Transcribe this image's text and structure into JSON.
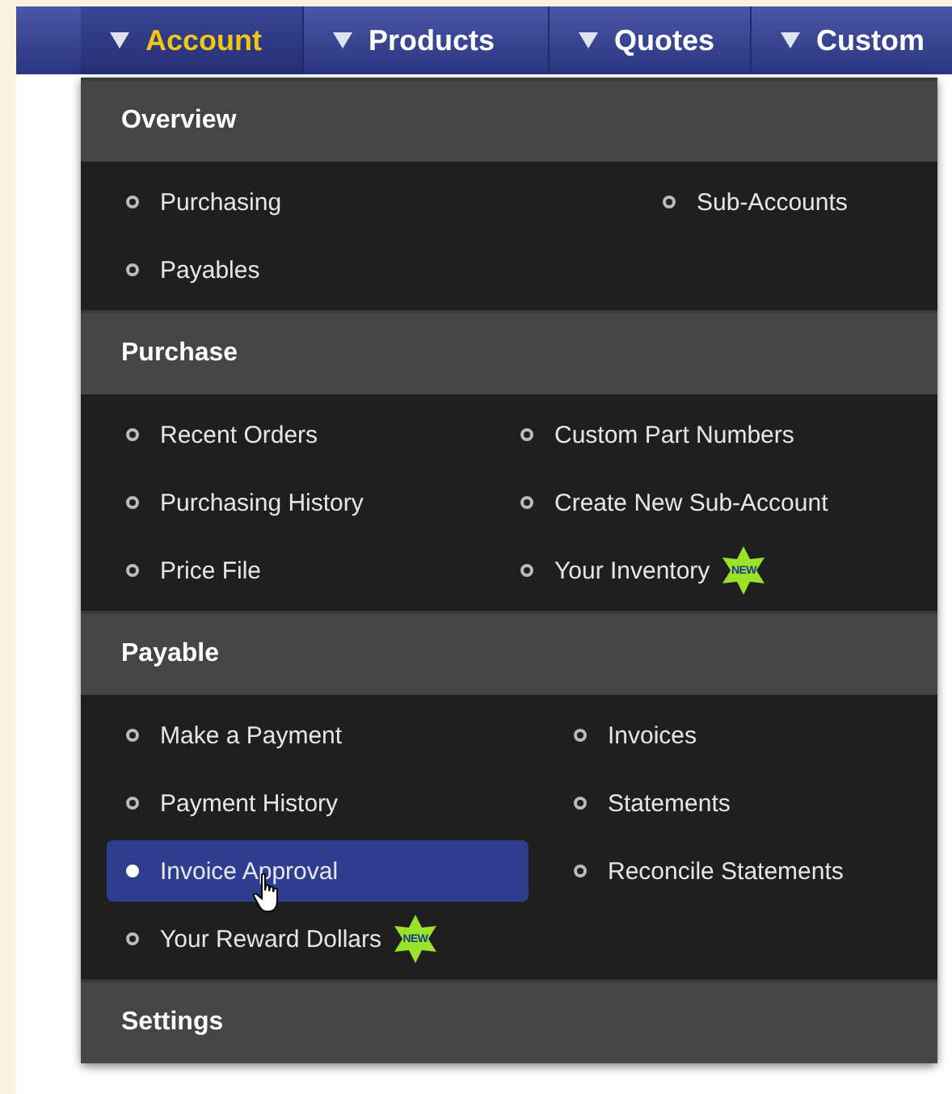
{
  "nav": {
    "tabs": [
      {
        "label": "Account",
        "selected": true
      },
      {
        "label": "Products",
        "selected": false
      },
      {
        "label": "Quotes",
        "selected": false
      },
      {
        "label": "Custom",
        "selected": false
      }
    ]
  },
  "menu": {
    "sections": [
      {
        "title": "Overview",
        "columns": [
          [
            {
              "label": "Purchasing",
              "selected": false
            },
            {
              "label": "Payables",
              "selected": false
            }
          ],
          [
            {
              "label": "Sub-Accounts",
              "selected": false
            }
          ]
        ]
      },
      {
        "title": "Purchase",
        "columns": [
          [
            {
              "label": "Recent Orders",
              "selected": false
            },
            {
              "label": "Purchasing History",
              "selected": false
            },
            {
              "label": "Price File",
              "selected": false
            }
          ],
          [
            {
              "label": "Custom Part Numbers",
              "selected": false
            },
            {
              "label": "Create New Sub-Account",
              "selected": false
            },
            {
              "label": "Your Inventory",
              "selected": false,
              "badge": "NEW"
            }
          ]
        ]
      },
      {
        "title": "Payable",
        "columns": [
          [
            {
              "label": "Make a Payment",
              "selected": false
            },
            {
              "label": "Payment History",
              "selected": false
            },
            {
              "label": "Invoice Approval",
              "selected": true
            },
            {
              "label": "Your Reward Dollars",
              "selected": false,
              "badge": "NEW"
            }
          ],
          [
            {
              "label": "Invoices",
              "selected": false
            },
            {
              "label": "Statements",
              "selected": false
            },
            {
              "label": "Reconcile Statements",
              "selected": false
            }
          ]
        ]
      },
      {
        "title": "Settings"
      }
    ]
  }
}
